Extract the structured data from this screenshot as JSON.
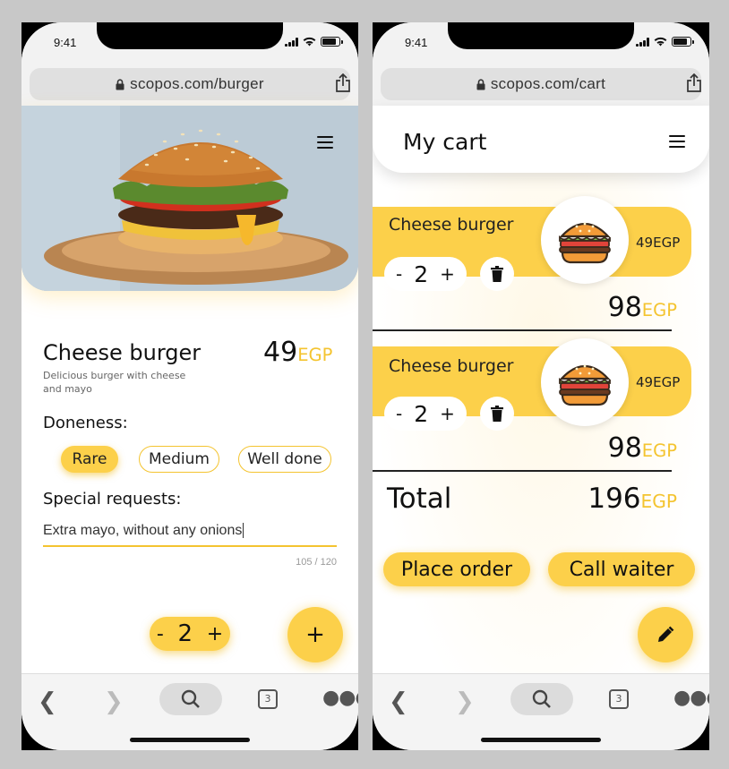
{
  "status": {
    "time": "9:41"
  },
  "browser": {
    "tab_count": "3"
  },
  "left": {
    "url": "scopos.com/burger",
    "product": {
      "name": "Cheese burger",
      "price": "49",
      "currency": "EGP",
      "description": "Delicious burger with cheese and mayo"
    },
    "doneness": {
      "label": "Doneness:",
      "options": [
        "Rare",
        "Medium",
        "Well done"
      ],
      "selected": "Rare"
    },
    "special_requests": {
      "label": "Special requests:",
      "value": "Extra mayo, without any onions",
      "counter": "105 / 120"
    },
    "quantity": {
      "minus": "-",
      "value": "2",
      "plus": "+"
    },
    "fab": {
      "label": "+"
    }
  },
  "right": {
    "url": "scopos.com/cart",
    "title": "My cart",
    "items": [
      {
        "name": "Cheese burger",
        "quantity": "2",
        "unit_price": "49EGP",
        "subtotal": "98",
        "currency": "EGP"
      },
      {
        "name": "Cheese burger",
        "quantity": "2",
        "unit_price": "49EGP",
        "subtotal": "98",
        "currency": "EGP"
      }
    ],
    "stepper": {
      "minus": "-",
      "plus": "+"
    },
    "total": {
      "label": "Total",
      "value": "196",
      "currency": "EGP"
    },
    "actions": {
      "place_order": "Place order",
      "call_waiter": "Call waiter"
    }
  },
  "colors": {
    "accent": "#fcd04a",
    "currency": "#f4c430",
    "text": "#111111"
  },
  "icons": [
    "lock-icon",
    "share-icon",
    "menu-icon",
    "trash-icon",
    "burger-icon",
    "pencil-icon",
    "search-icon",
    "back-icon",
    "forward-icon",
    "tabs-icon",
    "more-icon"
  ]
}
